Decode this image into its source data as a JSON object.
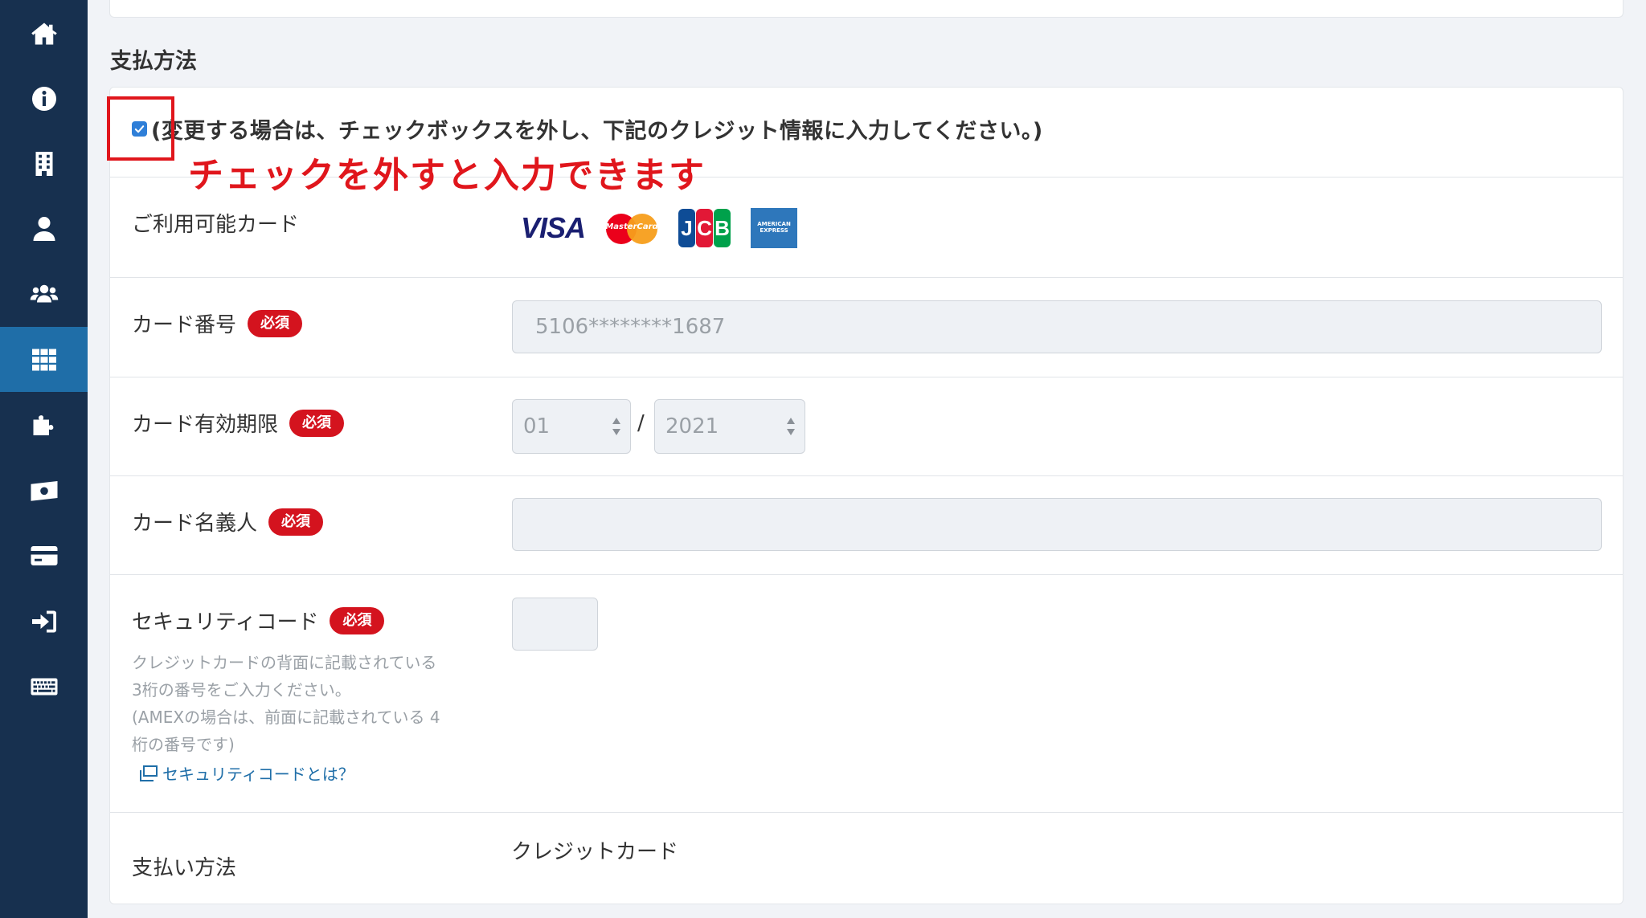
{
  "section": {
    "title": "支払方法"
  },
  "checkbox": {
    "label": "(変更する場合は、チェックボックスを外し、下記のクレジット情報に入力してください。)",
    "checked": true
  },
  "annotation": {
    "text": "チェックを外すと入力できます",
    "color": "#e0161c"
  },
  "cards_row": {
    "label": "ご利用可能カード",
    "brands": [
      "VISA",
      "MasterCard",
      "JCB",
      "AMERICAN EXPRESS"
    ]
  },
  "card_number": {
    "label": "カード番号",
    "badge": "必須",
    "value": "5106********1687"
  },
  "expiry": {
    "label": "カード有効期限",
    "badge": "必須",
    "month": "01",
    "separator": "/",
    "year": "2021"
  },
  "holder": {
    "label": "カード名義人",
    "badge": "必須",
    "value": ""
  },
  "security": {
    "label": "セキュリティコード",
    "badge": "必須",
    "help_lines": [
      "クレジットカードの背面に記載されている",
      "3桁の番号をご入力ください。",
      "(AMEXの場合は、前面に記載されている 4",
      "桁の番号です)"
    ],
    "link": "セキュリティコードとは？"
  },
  "payment_method": {
    "label": "支払い方法",
    "value": "クレジットカード"
  },
  "sidebar": {
    "icons": [
      "home-icon",
      "info-icon",
      "building-icon",
      "user-icon",
      "users-icon",
      "grid-icon",
      "puzzle-icon",
      "money-icon",
      "credit-card-icon",
      "sign-in-icon",
      "keyboard-icon"
    ],
    "active": "grid-icon"
  },
  "colors": {
    "sidebar": "#17304f",
    "sidebar_active": "#1f6ea8",
    "badge": "#d4131e",
    "link": "#1f6ea8"
  }
}
